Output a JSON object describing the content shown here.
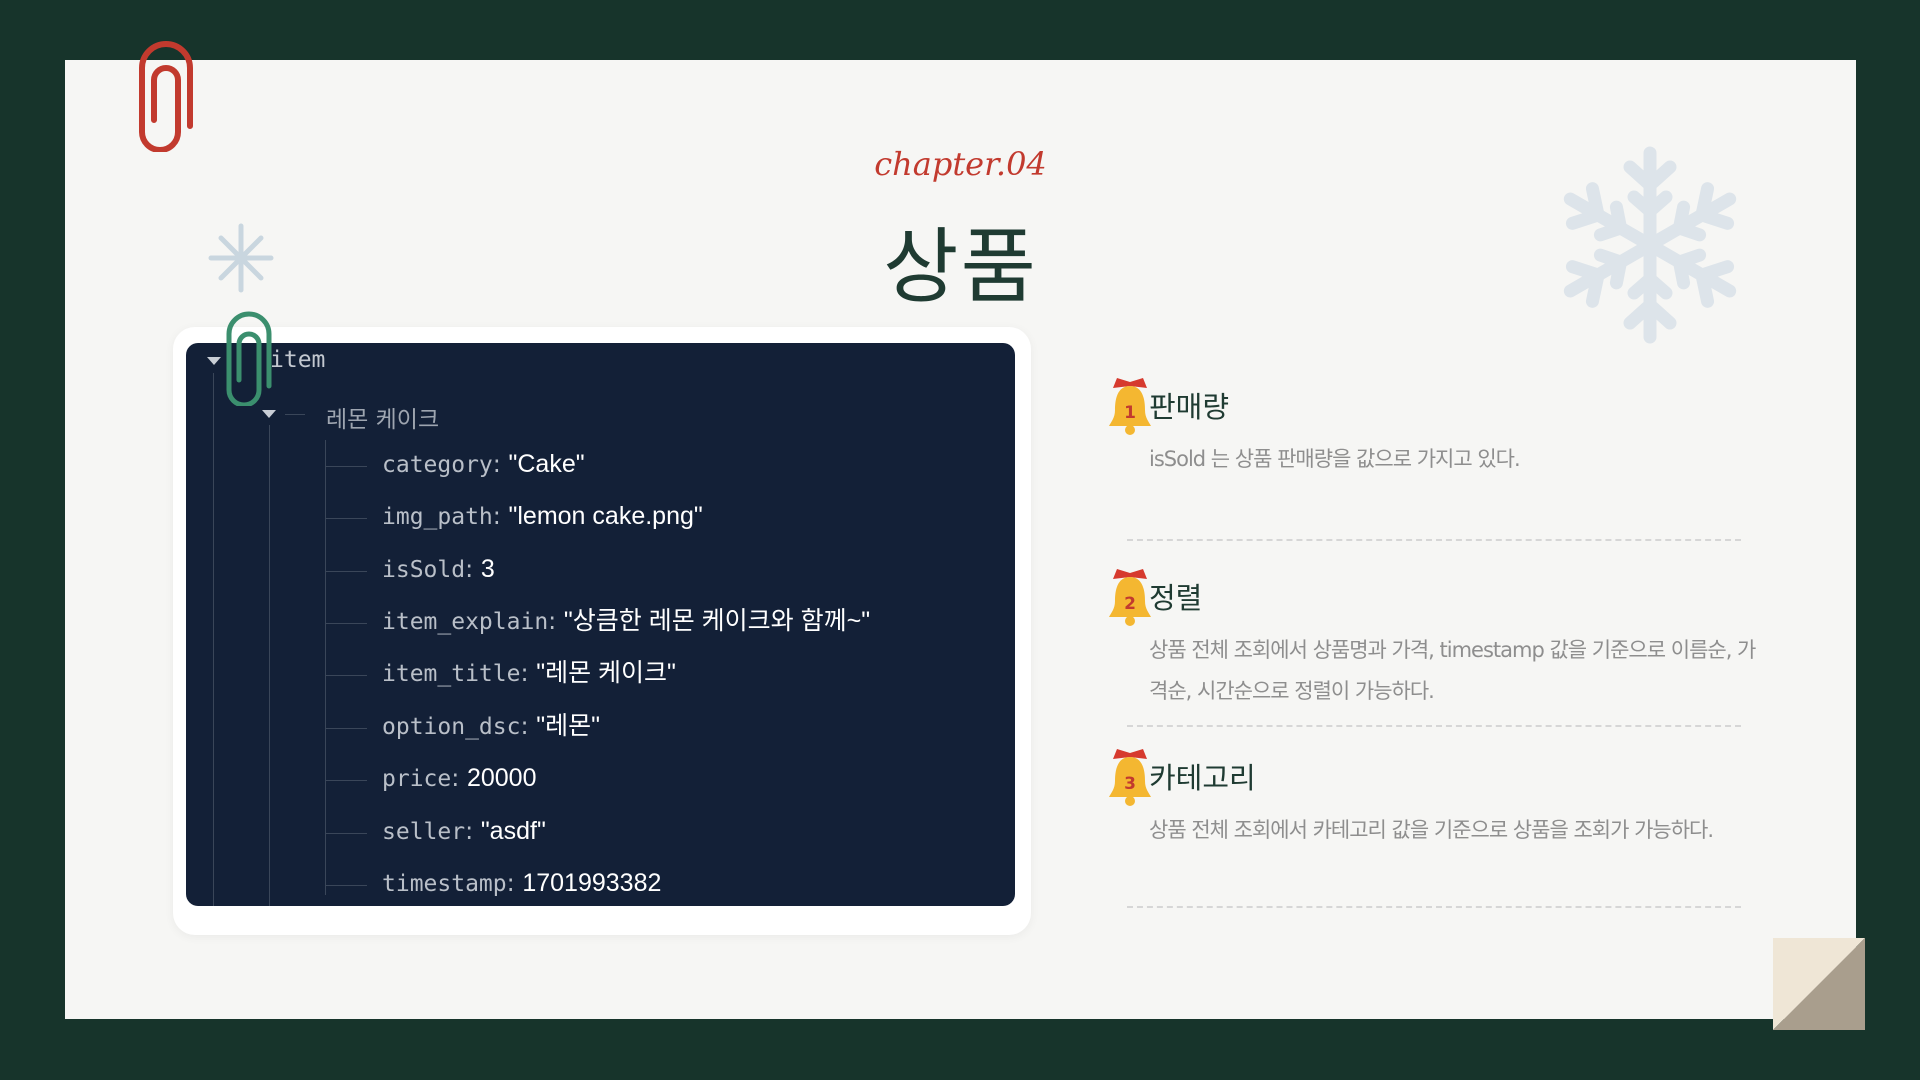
{
  "header": {
    "chapter": "chapter.04",
    "title": "상품"
  },
  "code_tree": {
    "root": "item",
    "node": "레몬 케이크",
    "fields": [
      {
        "key": "category",
        "value": "\"Cake\""
      },
      {
        "key": "img_path",
        "value": "\"lemon cake.png\""
      },
      {
        "key": "isSold",
        "value": "3"
      },
      {
        "key": "item_explain",
        "value": "\"상큼한 레몬 케이크와 함께~\""
      },
      {
        "key": "item_title",
        "value": "\"레몬 케이크\""
      },
      {
        "key": "option_dsc",
        "value": "\"레몬\""
      },
      {
        "key": "price",
        "value": "20000"
      },
      {
        "key": "seller",
        "value": "\"asdf\""
      },
      {
        "key": "timestamp",
        "value": "1701993382"
      }
    ]
  },
  "features": [
    {
      "number": "1",
      "name": "판매량",
      "desc": "isSold 는 상품 판매량을 값으로 가지고 있다."
    },
    {
      "number": "2",
      "name": "정렬",
      "desc": "상품 전체 조회에서 상품명과 가격, timestamp 값을 기준으로 이름순, 가격순, 시간순으로 정렬이 가능하다."
    },
    {
      "number": "3",
      "name": "카테고리",
      "desc": "상품 전체 조회에서 카테고리 값을 기준으로 상품을 조회가 가능하다."
    }
  ],
  "colors": {
    "background": "#17342b",
    "slide": "#f6f6f4",
    "accent_red": "#c23a2e",
    "title_green": "#1f3b32",
    "code_bg": "#132037",
    "bell": "#f4b731"
  }
}
